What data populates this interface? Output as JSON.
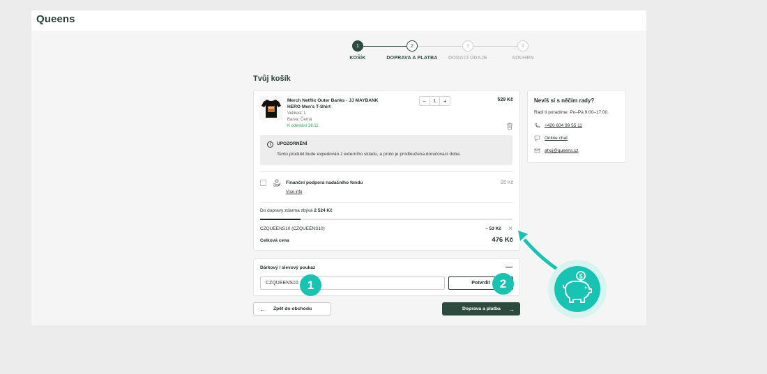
{
  "brand": {
    "logo": "Queens"
  },
  "stepper": {
    "steps": [
      {
        "number": "1",
        "label": "KOŠÍK",
        "state": "active"
      },
      {
        "number": "2",
        "label": "DOPRAVA A PLATBA",
        "state": "next"
      },
      {
        "number": "3",
        "label": "DODACÍ ÚDAJE",
        "state": "inactive"
      },
      {
        "number": "4",
        "label": "SOUHRN",
        "state": "inactive"
      }
    ]
  },
  "cart": {
    "title": "Tvůj košík",
    "item": {
      "name": "Merch Netflix Outer Banks - JJ MAYBANK HERO Men's T-Shirt",
      "size": "Velikost: L",
      "color": "Barva: Černá",
      "dispatch": "K odeslání 26.11.",
      "quantity": "1",
      "minus": "−",
      "plus": "+",
      "price": "529 Kč"
    },
    "notice": {
      "title": "UPOZORNĚNÍ",
      "text": "Tento produkt bude expedován z externího skladu, a proto je prodloužena doručovací doba."
    },
    "fund": {
      "label": "Finanční podpora nadačního fondu",
      "link": "Více info",
      "price": "25 Kč"
    },
    "free_shipping": {
      "prefix": "Do dopravy zdarma zbývá",
      "amount": "2 524 Kč",
      "progress": 0.16
    },
    "coupon": {
      "code": "CZQUEENS10 (CZQUEENS10)",
      "discount": "– 53 Kč"
    },
    "total": {
      "label": "Celková cena",
      "value": "476 Kč"
    }
  },
  "gift": {
    "title": "Dárkový / slevový poukaz",
    "toggle": "—",
    "input_value": "CZQUEENS10",
    "confirm": "Potvrdit"
  },
  "nav": {
    "back": "Zpět do obchodu",
    "next": "Doprava a platba"
  },
  "help": {
    "title": "Nevíš si s něčím rady?",
    "text": "Rádi ti poradíme. Po–Pá 9:00–17:00.",
    "phone": "+420 604 99 55 11",
    "chat": "Online chat",
    "email": "ahoj@queens.cz"
  },
  "annotations": {
    "badge1": "1",
    "badge2": "2"
  },
  "colors": {
    "brand": "#2d4a3f",
    "accent": "#17c3b2",
    "green": "#2f9e5a"
  }
}
